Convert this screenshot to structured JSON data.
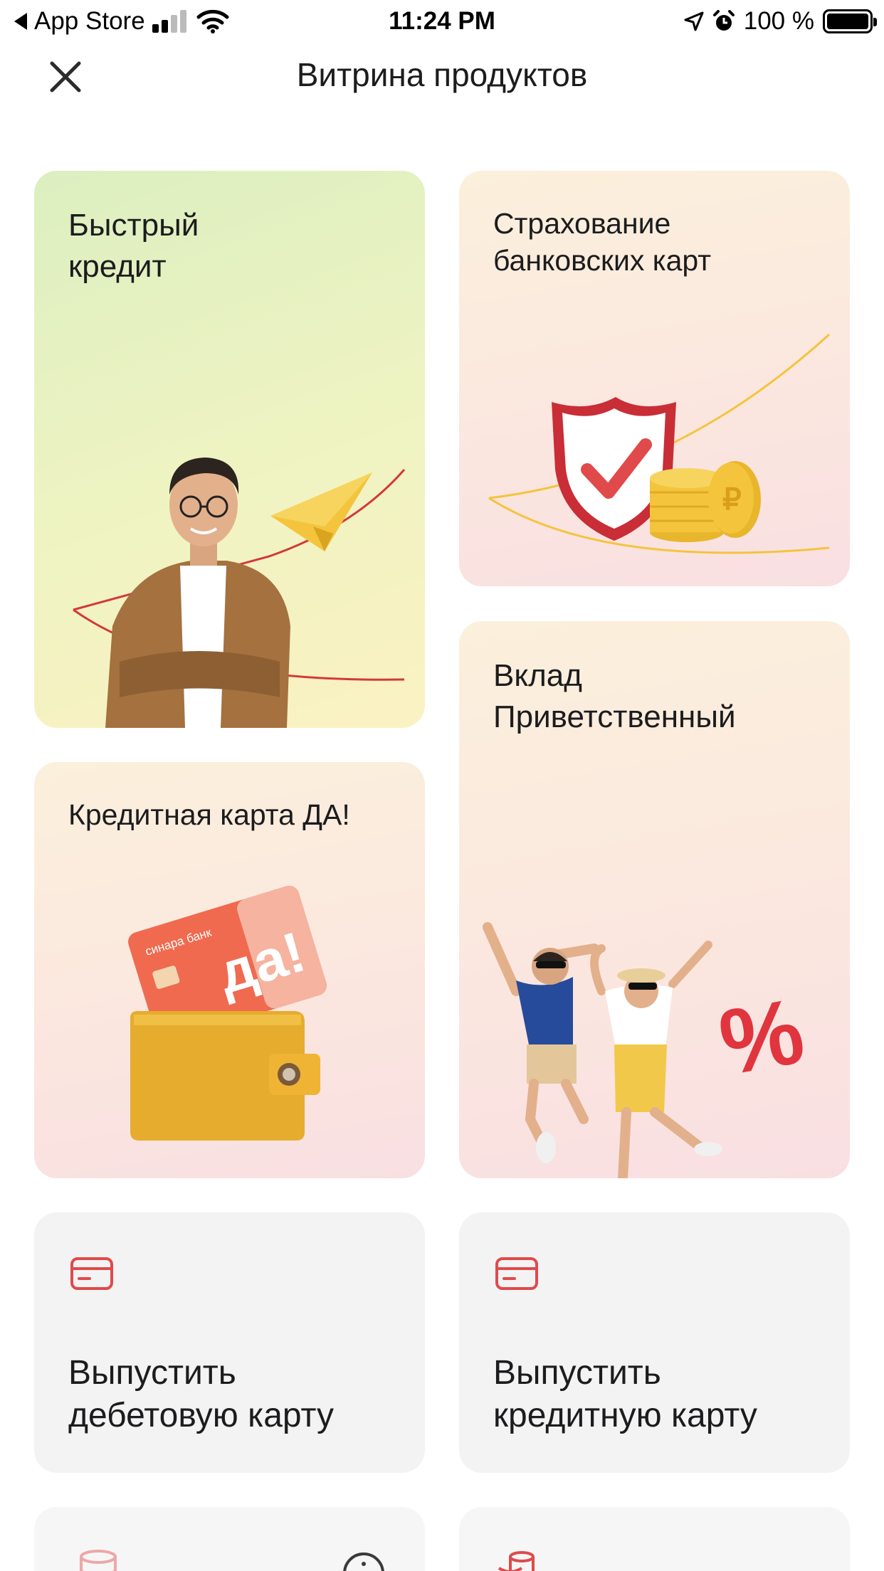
{
  "status_bar": {
    "back_app": "App Store",
    "time": "11:24 PM",
    "battery_text": "100 %",
    "battery_level": 1.0
  },
  "nav": {
    "title": "Витрина продуктов",
    "close_icon": "close-icon"
  },
  "products": {
    "quick_credit": {
      "title": "Быстрый\nкредит"
    },
    "card_insurance": {
      "title": "Страхование\nбанковских карт"
    },
    "credit_card_da": {
      "title": "Кредитная карта ДА!",
      "card_brand": "синара банк",
      "card_text": "да!"
    },
    "welcome_deposit": {
      "title": "Вклад\nПриветственный",
      "percent_sign": "%"
    },
    "issue_debit": {
      "title": "Выпустить\nдебетовую карту",
      "icon": "credit-card-icon"
    },
    "issue_credit": {
      "title": "Выпустить\nкредитную карту",
      "icon": "credit-card-icon"
    },
    "bottom_left": {
      "icon": "coins-icon",
      "info_icon": "info-icon"
    },
    "bottom_right": {
      "icon": "coins-stack-icon"
    }
  },
  "colors": {
    "accent_red": "#e04a4a",
    "card_grey": "#f3f3f4",
    "coin_gold": "#f4c43d"
  }
}
